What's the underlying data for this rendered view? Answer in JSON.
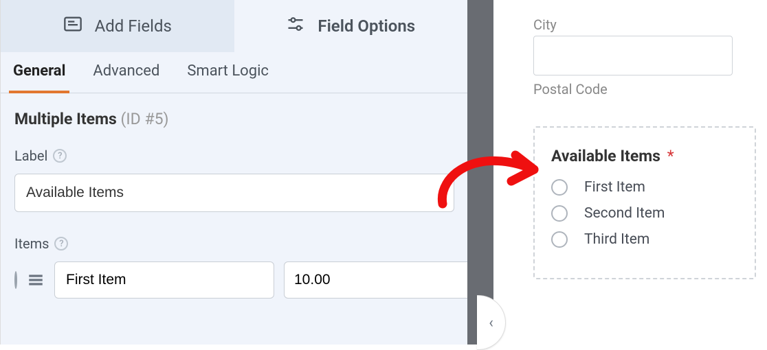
{
  "topTabs": {
    "addFields": "Add Fields",
    "fieldOptions": "Field Options"
  },
  "subTabs": {
    "general": "General",
    "advanced": "Advanced",
    "smartLogic": "Smart Logic"
  },
  "section": {
    "title": "Multiple Items",
    "id": "(ID #5)"
  },
  "labels": {
    "label": "Label",
    "items": "Items"
  },
  "labelValue": "Available Items",
  "itemRow": {
    "name": "First Item",
    "price": "10.00"
  },
  "preview": {
    "cityLabel": "City",
    "postalLabel": "Postal Code",
    "fieldTitle": "Available Items",
    "required": "*",
    "radios": [
      "First Item",
      "Second Item",
      "Third Item"
    ]
  }
}
